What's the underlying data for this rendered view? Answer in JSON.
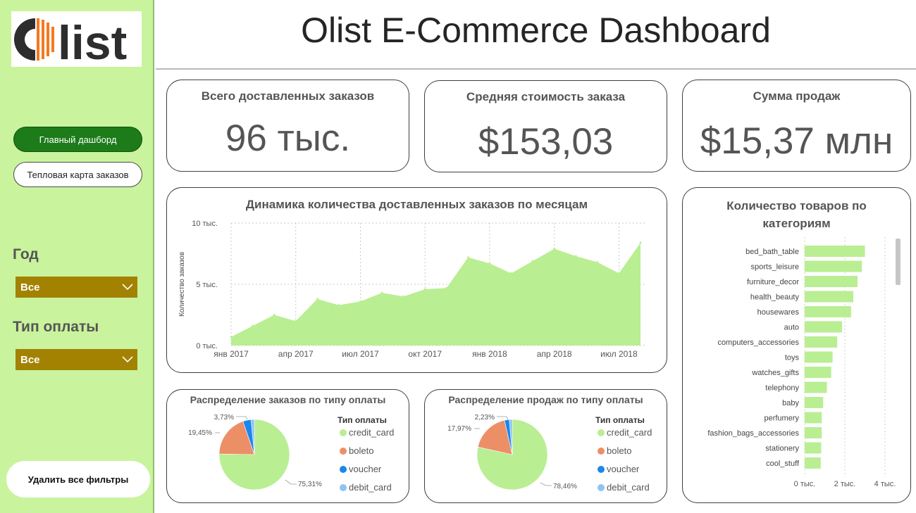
{
  "app": {
    "title": "Olist E-Commerce Dashboard",
    "logo_text": "Olist"
  },
  "sidebar": {
    "nav": [
      {
        "label": "Главный дашборд",
        "active": true
      },
      {
        "label": "Тепловая карта заказов",
        "active": false
      }
    ],
    "filters": {
      "year": {
        "label": "Год",
        "value": "Все"
      },
      "payment": {
        "label": "Тип оплаты",
        "value": "Все"
      }
    },
    "clear_label": "Удалить все фильтры"
  },
  "kpis": [
    {
      "title": "Всего доставленных заказов",
      "value": "96 тыс."
    },
    {
      "title": "Средняя стоимость заказа",
      "value": "$153,03"
    },
    {
      "title": "Сумма продаж",
      "value": "$15,37 млн"
    }
  ],
  "colors": {
    "sidebar_bg": "#c9f39d",
    "area_fill": "#b9ee93",
    "bar_fill": "#b9ee93",
    "credit_card": "#b9ee93",
    "boleto": "#ec8f67",
    "voucher": "#1a86f0",
    "debit_card": "#8cc4f3",
    "filter_bg": "#a28200",
    "nav_active": "#1d7b1a"
  },
  "chart_data": [
    {
      "type": "area",
      "title": "Динамика количества доставленных заказов по месяцам",
      "ylabel": "Количество заказов",
      "ylim": [
        0,
        10000
      ],
      "yticks": [
        {
          "value": 0,
          "label": "0 тыс."
        },
        {
          "value": 5000,
          "label": "5 тыс."
        },
        {
          "value": 10000,
          "label": "10 тыс."
        }
      ],
      "xticks": [
        {
          "index": 0,
          "label": "янв 2017"
        },
        {
          "index": 3,
          "label": "апр 2017"
        },
        {
          "index": 6,
          "label": "июл 2017"
        },
        {
          "index": 9,
          "label": "окт 2017"
        },
        {
          "index": 12,
          "label": "янв 2018"
        },
        {
          "index": 15,
          "label": "апр 2018"
        },
        {
          "index": 18,
          "label": "июл 2018"
        }
      ],
      "x": [
        "2017-01",
        "2017-02",
        "2017-03",
        "2017-04",
        "2017-05",
        "2017-06",
        "2017-07",
        "2017-08",
        "2017-09",
        "2017-10",
        "2017-11",
        "2017-12",
        "2018-01",
        "2018-02",
        "2018-03",
        "2018-04",
        "2018-05",
        "2018-06",
        "2018-07",
        "2018-08"
      ],
      "values": [
        700,
        1600,
        2500,
        2000,
        3800,
        3300,
        3600,
        4300,
        4000,
        4600,
        4700,
        7200,
        6700,
        5900,
        6900,
        7900,
        7300,
        6800,
        5900,
        8400
      ],
      "grid": true
    },
    {
      "type": "bar",
      "orientation": "horizontal",
      "title": "Количество товаров по категориям",
      "categories": [
        "bed_bath_table",
        "sports_leisure",
        "furniture_decor",
        "health_beauty",
        "housewares",
        "auto",
        "computers_accessories",
        "toys",
        "watches_gifts",
        "telephony",
        "baby",
        "perfumery",
        "fashion_bags_accessories",
        "stationery",
        "cool_stuff"
      ],
      "values": [
        3000,
        2850,
        2630,
        2420,
        2310,
        1860,
        1620,
        1390,
        1320,
        1110,
        920,
        850,
        850,
        820,
        800
      ],
      "xlim": [
        0,
        4000
      ],
      "xticks": [
        {
          "value": 0,
          "label": "0 тыс."
        },
        {
          "value": 2000,
          "label": "2 тыс."
        },
        {
          "value": 4000,
          "label": "4 тыс."
        }
      ],
      "grid": true
    },
    {
      "type": "pie",
      "title": "Распределение заказов по типу оплаты",
      "legend_title": "Тип оплаты",
      "legend_position": "right",
      "labels": [
        "credit_card",
        "boleto",
        "voucher",
        "debit_card"
      ],
      "values": [
        75.31,
        19.45,
        3.73,
        1.51
      ],
      "data_labels": [
        "75,31%",
        "19,45%",
        "3,73%",
        ""
      ]
    },
    {
      "type": "pie",
      "title": "Распределение продаж по типу оплаты",
      "legend_title": "Тип оплаты",
      "legend_position": "right",
      "labels": [
        "credit_card",
        "boleto",
        "voucher",
        "debit_card"
      ],
      "values": [
        78.46,
        17.97,
        2.23,
        1.34
      ],
      "data_labels": [
        "78,46%",
        "17,97%",
        "2,23%",
        ""
      ]
    }
  ]
}
